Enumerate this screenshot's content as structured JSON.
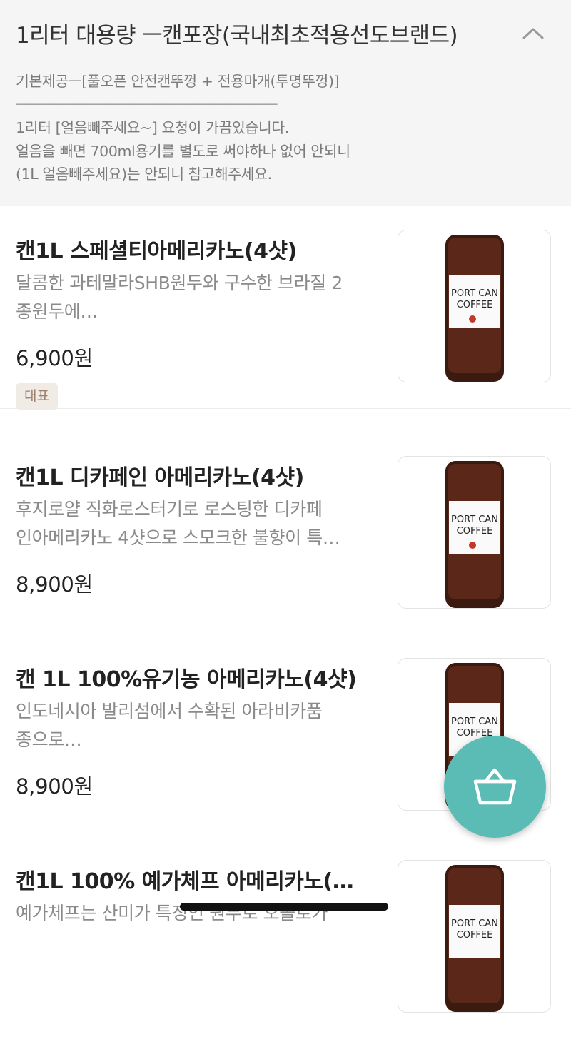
{
  "category": {
    "title": "1리터 대용량 ㅡ캔포장(국내최초적용선도브랜드)",
    "description_lines": [
      "기본제공ㅡ[풀오픈 안전캔뚜껑 + 전용마개(투명뚜껑)]",
      "ㅡㅡㅡㅡㅡㅡㅡㅡㅡㅡㅡㅡㅡㅡㅡㅡㅡㅡㅡㅡㅡㅡㅡ",
      "1리터  [얼음빼주세요~] 요청이 가끔있습니다.",
      "얼음을 빼면 700ml용기를 별도로 써야하나 없어 안되니",
      "(1L 얼음빼주세요)는 안되니 참고해주세요."
    ],
    "collapse_icon": "chevron-up-icon"
  },
  "items": [
    {
      "name": "캔1L 스페셜티아메리카노(4샷)",
      "desc_lines": [
        "달콤한 과테말라SHB원두와 구수한 브라질 2",
        "종원두에…"
      ],
      "price": "6,900원",
      "badge": "대표"
    },
    {
      "name": "캔1L  디카페인 아메리카노(4샷)",
      "desc_lines": [
        "후지로얄 직화로스터기로 로스팅한 디카페",
        "인아메리카노 4샷으로 스모크한 불향이 특…"
      ],
      "price": "8,900원"
    },
    {
      "name": "캔 1L 100%유기농 아메리카노(4샷)",
      "desc_lines": [
        "인도네시아 발리섬에서 수확된 아라비카품",
        "종으로…"
      ],
      "price": "8,900원"
    },
    {
      "name": "캔1L 100% 예가체프 아메리카노(…",
      "desc_lines": [
        "예가체프는 산미가 특징인 원두로 오볼로가"
      ],
      "price": ""
    }
  ],
  "product_image": {
    "label_line1": "PORT CAN",
    "label_line2": "COFFEE"
  },
  "cart_button": {
    "icon": "basket-icon",
    "color": "#5bbbb5"
  }
}
